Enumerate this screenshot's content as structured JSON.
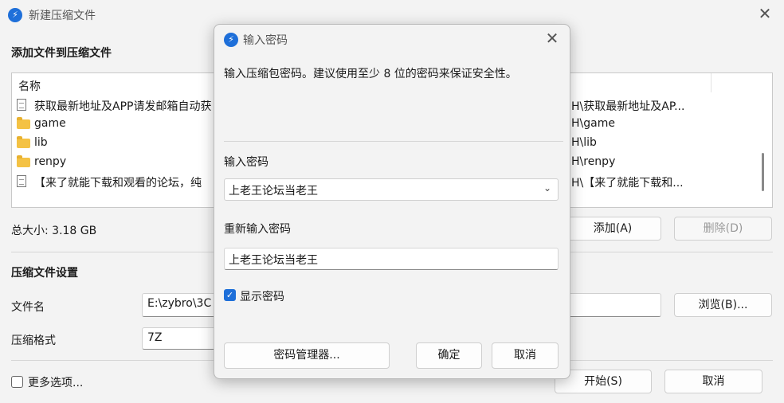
{
  "main": {
    "title": "新建压缩文件",
    "add_section_title": "添加文件到压缩文件",
    "list": {
      "column_name": "名称",
      "rows": [
        {
          "icon": "file-icon",
          "name": "获取最新地址及APP请发邮箱自动获",
          "path": "H\\获取最新地址及AP..."
        },
        {
          "icon": "folder-icon",
          "name": "game",
          "path": "H\\game"
        },
        {
          "icon": "folder-icon",
          "name": "lib",
          "path": "H\\lib"
        },
        {
          "icon": "folder-icon",
          "name": "renpy",
          "path": "H\\renpy"
        },
        {
          "icon": "file-icon",
          "name": "【来了就能下载和观看的论坛，纯",
          "path": "H\\【来了就能下载和..."
        }
      ]
    },
    "total_size": "总大小: 3.18 GB",
    "add_button": "添加(A)",
    "delete_button": "删除(D)",
    "settings_title": "压缩文件设置",
    "filename_label": "文件名",
    "filename_value": "E:\\zybro\\3C",
    "browse_button": "浏览(B)...",
    "format_label": "压缩格式",
    "format_value": "7Z",
    "more_options": "更多选项...",
    "start_button": "开始(S)",
    "cancel_button": "取消"
  },
  "dialog": {
    "title": "输入密码",
    "hint": "输入压缩包密码。建议使用至少 8 位的密码来保证安全性。",
    "password_label": "输入密码",
    "password_value": "上老王论坛当老王",
    "reenter_label": "重新输入密码",
    "reenter_value": "上老王论坛当老王",
    "show_password_label": "显示密码",
    "show_password_checked": true,
    "manager_button": "密码管理器...",
    "ok_button": "确定",
    "cancel_button": "取消"
  },
  "colors": {
    "accent": "#1e6fd9",
    "window_bg": "#f3f3f3"
  }
}
